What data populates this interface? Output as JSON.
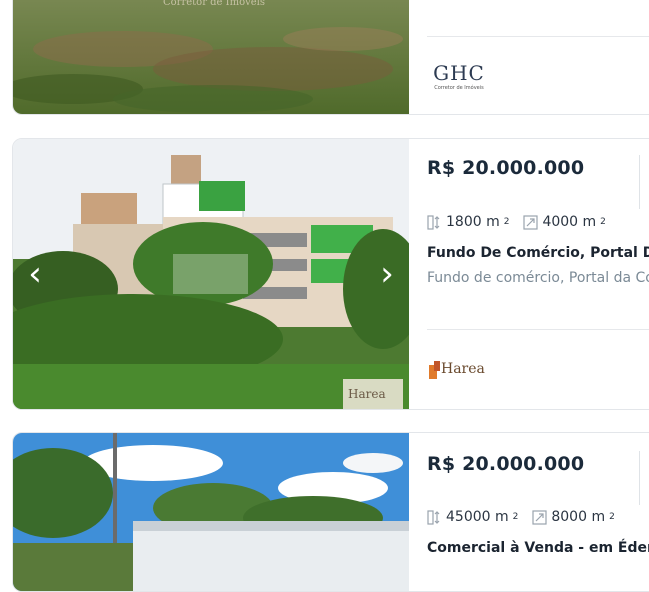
{
  "listings": [
    {
      "photo_watermark": "Corretor de Imóveis",
      "agency_logo_text": "GHC",
      "agency_logo_subtext": "Corretor de Imóveis"
    },
    {
      "price": "R$ 20.000.000",
      "area_total": "1800 m",
      "area_built": "4000 m",
      "area_unit_sup": "2",
      "title": "Fundo De Comércio, Portal Da Co",
      "subtitle": "Fundo de comércio, Portal da Coli",
      "agency_logo_text": "Harea",
      "photo_watermark": "Harea"
    },
    {
      "price": "R$ 20.000.000",
      "area_total": "45000 m",
      "area_built": "8000 m",
      "area_unit_sup": "2",
      "title": "Comercial à Venda - em Éden"
    }
  ],
  "controls": {
    "prev_arrow": "‹",
    "next_arrow": "›"
  },
  "colors": {
    "price": "#1b2a3a",
    "subtitle": "#7b8a96",
    "border": "#e3e6ea"
  }
}
